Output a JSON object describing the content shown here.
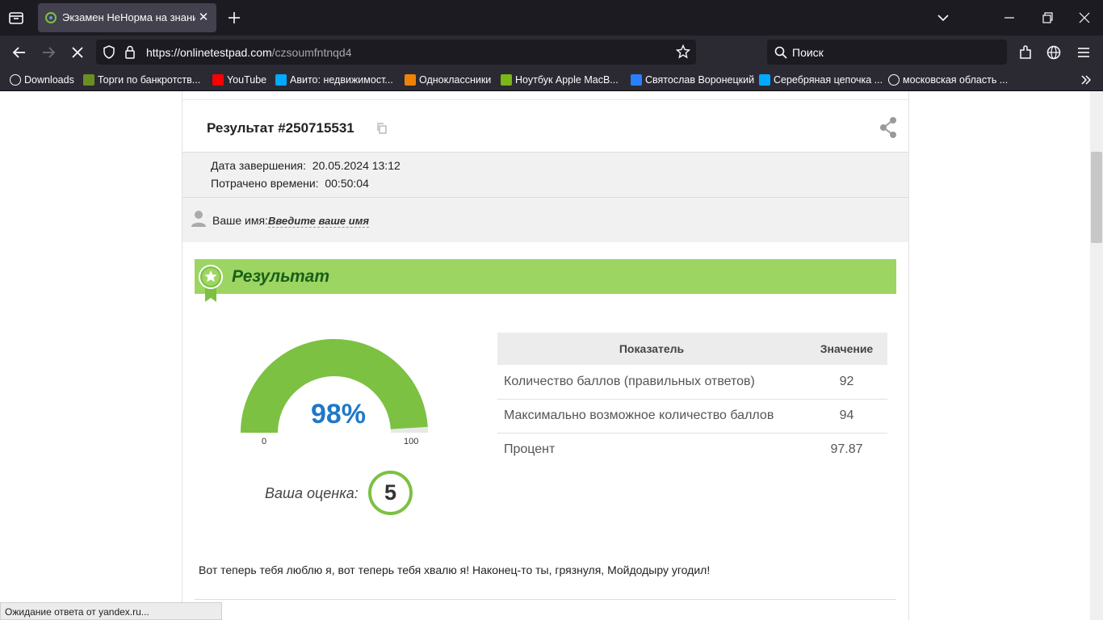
{
  "browser": {
    "tab_title": "Экзамен НеНорма на знание р",
    "url_host": "https://onlinetestpad.com",
    "url_path": "/czsoumfntnqd4",
    "search_placeholder": "Поиск",
    "status_text": "Ожидание ответа от yandex.ru..."
  },
  "bookmarks": [
    {
      "label": "Downloads",
      "icon": "globe-icon",
      "color": "#fbfbfe"
    },
    {
      "label": "Торги по банкротств...",
      "icon": "hammer-icon",
      "color": "#6b8e23"
    },
    {
      "label": "YouTube",
      "icon": "youtube-icon",
      "color": "#ff0000"
    },
    {
      "label": "Авито: недвижимост...",
      "icon": "avito-icon",
      "color": "#00aaff"
    },
    {
      "label": "Одноклассники",
      "icon": "ok-icon",
      "color": "#ee8208"
    },
    {
      "label": "Ноутбук Apple MacB...",
      "icon": "eldorado-icon",
      "color": "#7cb518"
    },
    {
      "label": "Святослав Воронецкий",
      "icon": "chat-icon",
      "color": "#2a7fff"
    },
    {
      "label": "Серебряная цепочка ...",
      "icon": "avito-icon",
      "color": "#00aaff"
    },
    {
      "label": "московская область ...",
      "icon": "globe-icon",
      "color": "#fbfbfe"
    }
  ],
  "result": {
    "title": "Результат #250715531",
    "completed_label": "Дата завершения:",
    "completed_value": "20.05.2024 13:12",
    "spent_label": "Потрачено времени:",
    "spent_value": "00:50:04",
    "name_label": "Ваше имя:",
    "name_value": "Введите ваше имя",
    "banner_title": "Результат",
    "gauge_percent": "98%",
    "gauge_value": 0.98,
    "gauge_min": "0",
    "gauge_max": "100",
    "grade_label": "Ваша оценка:",
    "grade_value": "5",
    "table": {
      "headers": [
        "Показатель",
        "Значение"
      ],
      "rows": [
        [
          "Количество баллов (правильных ответов)",
          "92"
        ],
        [
          "Максимально возможное количество баллов",
          "94"
        ],
        [
          "Процент",
          "97.87"
        ]
      ]
    },
    "message": "Вот теперь тебя люблю я, вот теперь тебя хвалю я! Наконец-то ты, грязнуля, Мойдодыру угодил!"
  },
  "colors": {
    "accent_green": "#7cc142",
    "banner_green": "#9cd562",
    "percent_blue": "#1f78c8"
  }
}
